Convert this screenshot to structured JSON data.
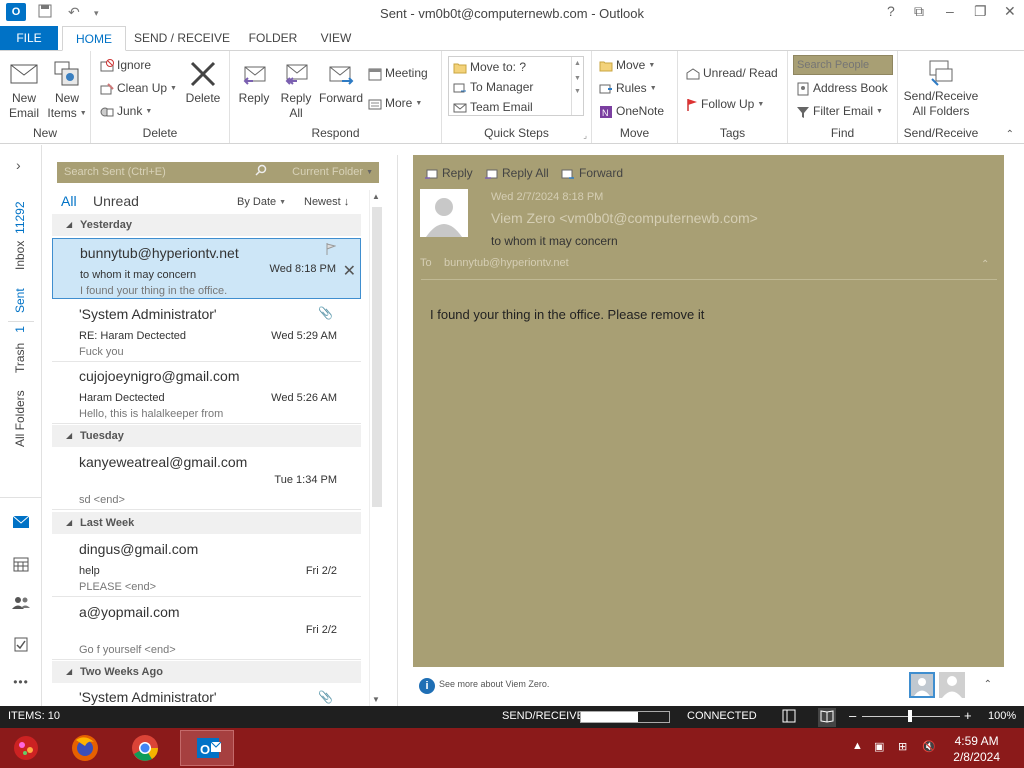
{
  "window": {
    "title": "Sent - vm0b0t@computernewb.com - Outlook",
    "app_icon_label": "O",
    "controls": [
      "?",
      "⧉",
      "–",
      "❐",
      "✕"
    ]
  },
  "tabs": {
    "file": "FILE",
    "items": [
      "HOME",
      "SEND / RECEIVE",
      "FOLDER",
      "VIEW"
    ],
    "active": "HOME"
  },
  "ribbon": {
    "new": {
      "label": "New",
      "new_email": [
        "New",
        "Email"
      ],
      "new_items": [
        "New",
        "Items"
      ]
    },
    "delete": {
      "label": "Delete",
      "ignore": "Ignore",
      "clean_up": "Clean Up",
      "junk": "Junk",
      "delete": "Delete"
    },
    "respond": {
      "label": "Respond",
      "reply": "Reply",
      "reply_all": [
        "Reply",
        "All"
      ],
      "forward": "Forward",
      "meeting": "Meeting",
      "more": "More"
    },
    "quick_steps": {
      "label": "Quick Steps",
      "items": [
        "Move to: ?",
        "To Manager",
        "Team Email"
      ]
    },
    "move": {
      "label": "Move",
      "move": "Move",
      "rules": "Rules",
      "onenote": "OneNote"
    },
    "tags": {
      "label": "Tags",
      "unread_read": "Unread/ Read",
      "follow_up": "Follow Up"
    },
    "find": {
      "label": "Find",
      "search_people_placeholder": "Search People",
      "address_book": "Address Book",
      "filter_email": "Filter Email"
    },
    "send_receive": {
      "label": "Send/Receive",
      "button": [
        "Send/Receive",
        "All Folders"
      ]
    }
  },
  "nav": {
    "inbox": "Inbox",
    "inbox_count": "11292",
    "sent": "Sent",
    "trash": "Trash",
    "trash_count": "1",
    "all_folders": "All Folders",
    "expand": "›",
    "more": "•••"
  },
  "mail_list": {
    "search_placeholder": "Search Sent (Ctrl+E)",
    "search_scope": "Current Folder",
    "filter_all": "All",
    "filter_unread": "Unread",
    "sort_by": "By Date",
    "sort_order": "Newest",
    "groups": [
      {
        "header": "Yesterday"
      },
      {
        "header": "Tuesday"
      },
      {
        "header": "Last Week"
      },
      {
        "header": "Two Weeks Ago"
      }
    ],
    "items": [
      {
        "from": "bunnytub@hyperiontv.net",
        "subject": "to whom it may concern",
        "preview": "I found your thing in the office.",
        "date": "Wed 8:18 PM"
      },
      {
        "from": "'System Administrator'",
        "subject": "RE: Haram Dectected",
        "preview": "Fuck you",
        "date": "Wed 5:29 AM"
      },
      {
        "from": "cujojoeynigro@gmail.com",
        "subject": "Haram Dectected",
        "preview": "Hello, this is halalkeeper from",
        "date": "Wed 5:26 AM"
      },
      {
        "from": "kanyeweatreal@gmail.com",
        "subject": "",
        "preview": "sd <end>",
        "date": "Tue 1:34 PM"
      },
      {
        "from": "dingus@gmail.com",
        "subject": "help",
        "preview": "PLEASE <end>",
        "date": "Fri 2/2"
      },
      {
        "from": "a@yopmail.com",
        "subject": "",
        "preview": "Go f yourself <end>",
        "date": "Fri 2/2"
      },
      {
        "from": "'System Administrator'",
        "subject": "",
        "preview": "",
        "date": ""
      }
    ]
  },
  "reading": {
    "actions": {
      "reply": "Reply",
      "reply_all": "Reply All",
      "forward": "Forward"
    },
    "date": "Wed 2/7/2024 8:18 PM",
    "from": "Viem Zero <vm0b0t@computernewb.com>",
    "subject": "to whom it may concern",
    "to_label": "To",
    "to": "bunnytub@hyperiontv.net",
    "body": "I found your thing in the office. Please remove it",
    "see_more": "See more about Viem Zero."
  },
  "status": {
    "items": "ITEMS: 10",
    "send_receive": "SEND/RECEIVE",
    "progress": 0.65,
    "connected": "CONNECTED",
    "zoom_minus": "–",
    "zoom_plus": "+",
    "zoom": "100%"
  },
  "taskbar": {
    "time": "4:59 AM",
    "date": "2/8/2024"
  },
  "colors": {
    "accent": "#0072c6",
    "reading_bg": "#a89f74",
    "selected_bg": "#cde6f7",
    "taskbar": "#8b1a1a"
  }
}
